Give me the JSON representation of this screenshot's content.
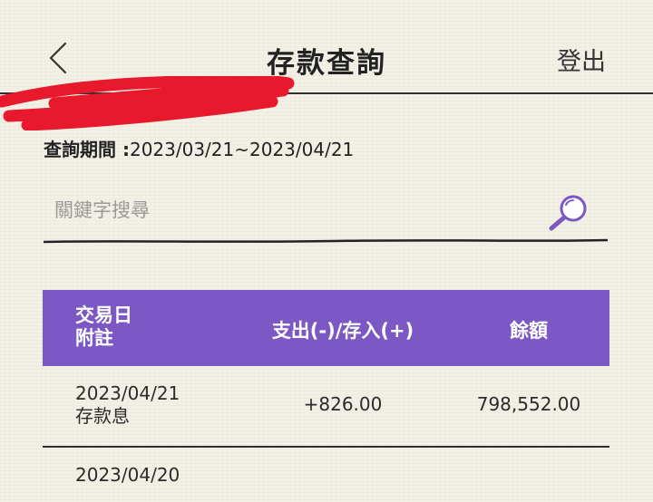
{
  "header": {
    "title": "存款查詢",
    "logout_label": "登出",
    "back_icon": "chevron-left-icon"
  },
  "query": {
    "period_label": "查詢期間 :",
    "period_value": "2023/03/21~2023/04/21"
  },
  "search": {
    "placeholder": "關鍵字搜尋",
    "value": "",
    "icon": "magnifier-icon"
  },
  "table": {
    "headers": {
      "date": "交易日",
      "note": "附註",
      "amount": "支出(-)/存入(+)",
      "balance": "餘額"
    },
    "rows": [
      {
        "date": "2023/04/21",
        "note": "存款息",
        "amount": "+826.00",
        "balance": "798,552.00"
      },
      {
        "date": "2023/04/20"
      }
    ]
  },
  "colors": {
    "accent": "#7b58c4",
    "background": "#f3f0e6",
    "redaction": "#e8192c"
  }
}
